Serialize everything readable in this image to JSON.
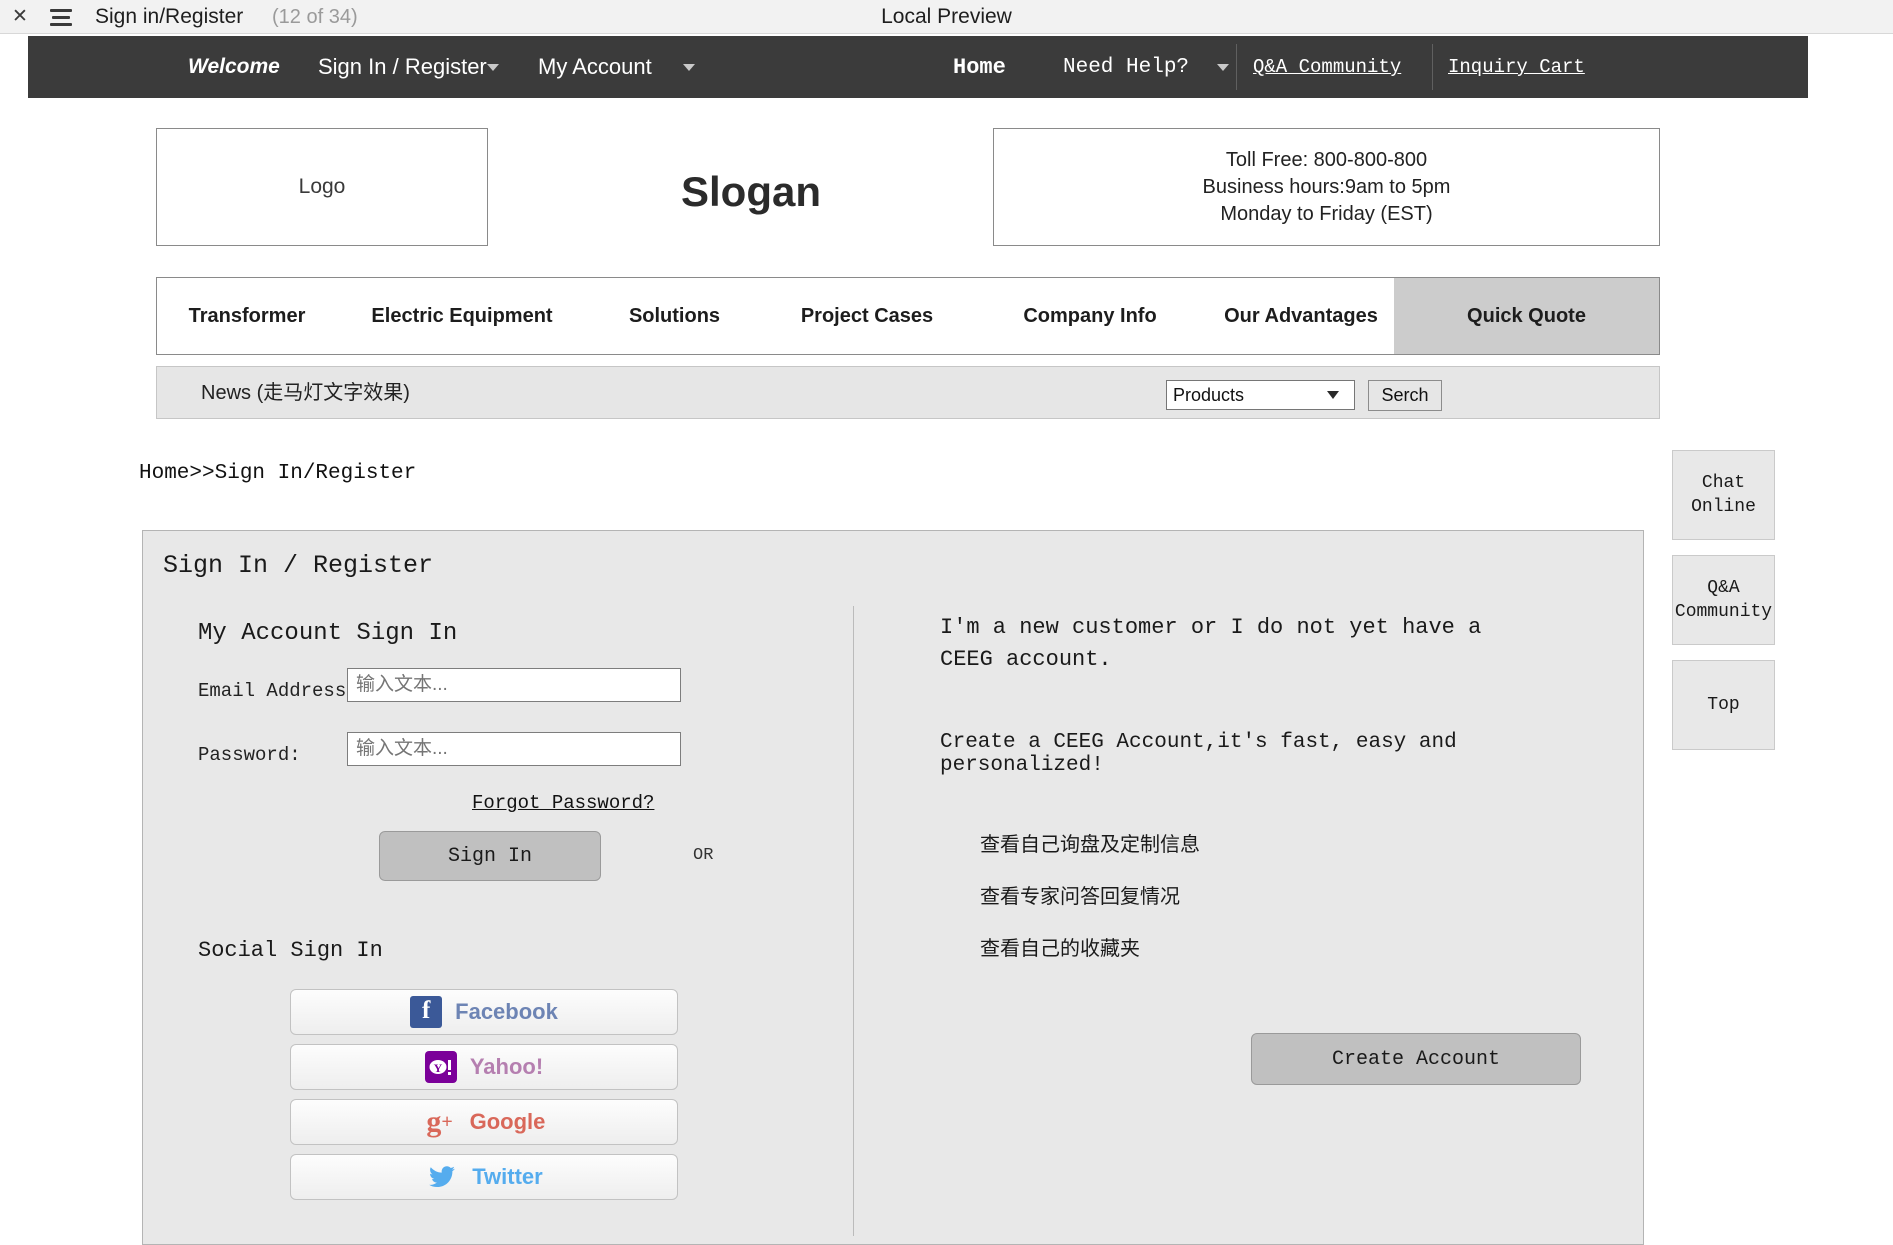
{
  "browser": {
    "close_icon": "close-icon",
    "menu_icon": "hamburger-icon",
    "title": "Sign in/Register",
    "count": "(12 of 34)",
    "preview_label": "Local Preview"
  },
  "topnav": {
    "welcome": "Welcome",
    "sign_in_register": "Sign In / Register",
    "my_account": "My Account",
    "home": "Home",
    "need_help": "Need Help?",
    "qa_community": "Q&A Community",
    "inquiry_cart": "Inquiry Cart",
    "background": "#3b3b3b"
  },
  "header": {
    "logo": "Logo",
    "slogan": "Slogan",
    "contact": {
      "toll_free": "Toll Free: 800-800-800",
      "hours": "Business hours:9am to 5pm",
      "days": "Monday to Friday (EST)"
    }
  },
  "menu": {
    "items": [
      {
        "label": "Transformer",
        "active": false
      },
      {
        "label": "Electric Equipment",
        "active": false
      },
      {
        "label": "Solutions",
        "active": false
      },
      {
        "label": "Project Cases",
        "active": false
      },
      {
        "label": "Company Info",
        "active": false
      },
      {
        "label": "Our Advantages",
        "active": false
      },
      {
        "label": "Quick Quote",
        "active": true
      }
    ],
    "active_background": "#cccccc"
  },
  "newsbar": {
    "news_text": "News (走马灯文字效果)",
    "search_category": "Products",
    "search_button": "Serch"
  },
  "breadcrumb": {
    "home": "Home",
    "separator": ">>",
    "current": "Sign In/Register",
    "full": "Home>>Sign In/Register"
  },
  "panel": {
    "title": "Sign In / Register",
    "or_label": "OR",
    "signin": {
      "heading": "My Account Sign In",
      "email_label": "Email Address:",
      "email_placeholder": "输入文本...",
      "password_label": "Password:",
      "password_placeholder": "输入文本...",
      "forgot_link": "Forgot Password?",
      "signin_button": "Sign In"
    },
    "social": {
      "heading": "Social Sign In",
      "buttons": [
        {
          "label": "Facebook",
          "icon": "facebook-icon",
          "color": "#6d84b4"
        },
        {
          "label": "Yahoo!",
          "icon": "yahoo-icon",
          "color": "#b57fb0"
        },
        {
          "label": "Google",
          "icon": "google-plus-icon",
          "color": "#d9685a"
        },
        {
          "label": "Twitter",
          "icon": "twitter-icon",
          "color": "#55acee"
        }
      ]
    },
    "register": {
      "new_customer_text": "I'm a new customer or I do not yet have a CEEG account.",
      "create_note": "Create a CEEG Account,it's fast, easy and personalized!",
      "benefits": [
        "查看自己询盘及定制信息",
        "查看专家问答回复情况",
        "查看自己的收藏夹"
      ],
      "create_button": "Create Account"
    }
  },
  "side_widgets": [
    {
      "label": "Chat Online",
      "name": "chat-online"
    },
    {
      "label": "Q&A Community",
      "name": "qa-community"
    },
    {
      "label": "Top",
      "name": "back-to-top"
    }
  ]
}
